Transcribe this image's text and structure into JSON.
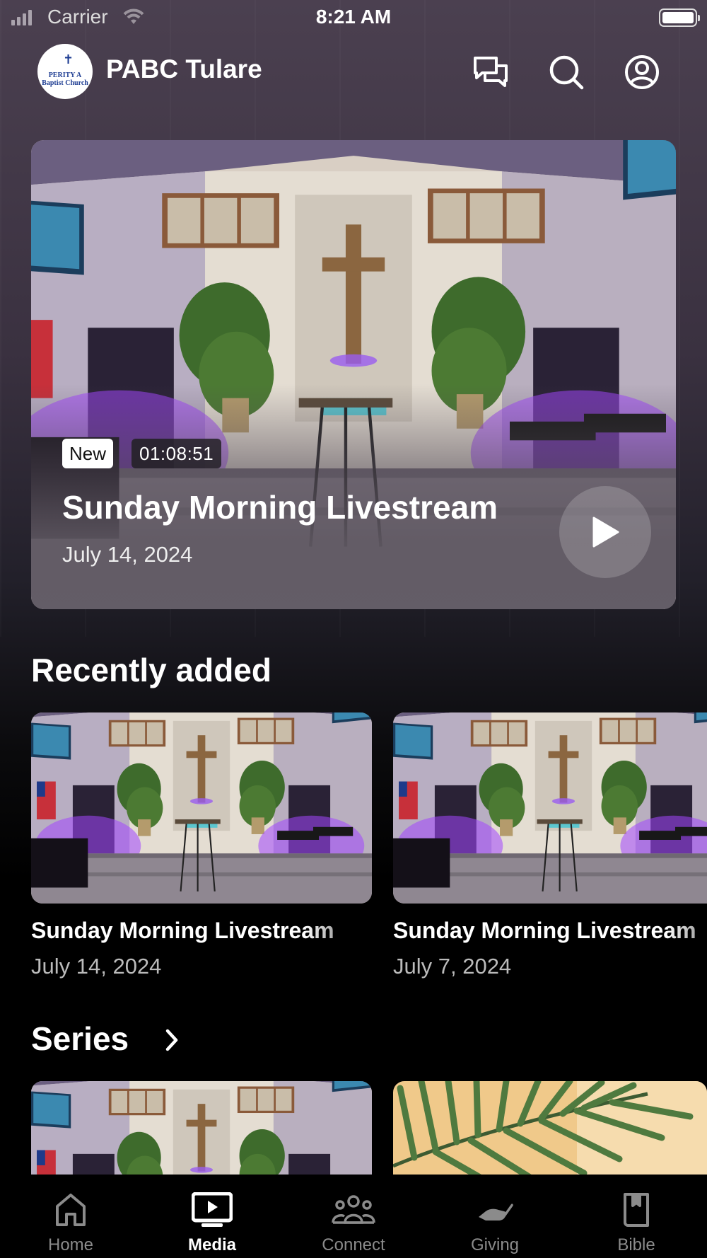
{
  "status_bar": {
    "carrier": "Carrier",
    "time": "8:21 AM"
  },
  "header": {
    "title": "PABC Tulare",
    "logo_text": "PERITY A\nBaptist Church",
    "icons": [
      "chat-icon",
      "search-icon",
      "account-icon"
    ]
  },
  "featured": {
    "badge": "New",
    "duration": "01:08:51",
    "title": "Sunday Morning Livestream",
    "date": "July 14, 2024"
  },
  "recently_added": {
    "heading": "Recently added",
    "items": [
      {
        "title": "Sunday Morning Livestream",
        "date": "July 14, 2024"
      },
      {
        "title": "Sunday Morning Livestream",
        "date": "July 7, 2024"
      }
    ]
  },
  "series": {
    "heading": "Series"
  },
  "tabs": [
    {
      "label": "Home",
      "icon": "home-icon",
      "active": false
    },
    {
      "label": "Media",
      "icon": "media-icon",
      "active": true
    },
    {
      "label": "Connect",
      "icon": "connect-icon",
      "active": false
    },
    {
      "label": "Giving",
      "icon": "giving-icon",
      "active": false
    },
    {
      "label": "Bible",
      "icon": "bible-icon",
      "active": false
    }
  ],
  "colors": {
    "background": "#000000",
    "header_tint": "#4b4050",
    "accent": "#ffffff",
    "inactive_tab": "#8b8b8b"
  }
}
